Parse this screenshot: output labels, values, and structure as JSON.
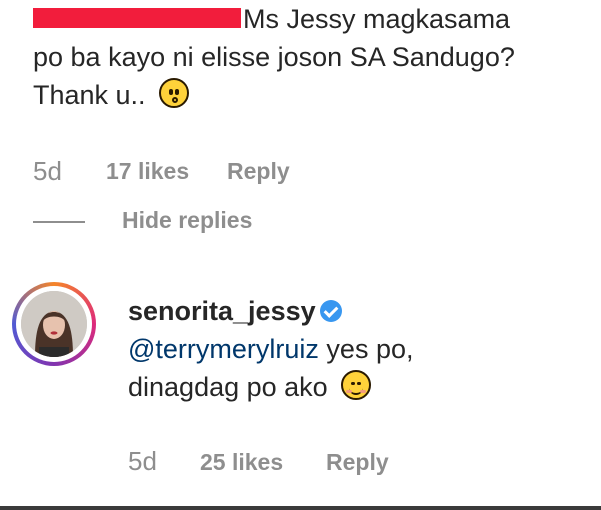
{
  "comment": {
    "username_redacted": "terrymerylruiz",
    "line1": "Ms Jessy magkasama",
    "line2": "po ba kayo ni elisse joson SA Sandugo?",
    "line3": "Thank u..",
    "emoji": "face-with-open-mouth-emoji",
    "meta": {
      "age": "5d",
      "likes": "17 likes",
      "reply": "Reply"
    },
    "hide_replies": "Hide replies"
  },
  "reply": {
    "username": "senorita_jessy",
    "mention": "@terrymerylruiz",
    "text1": " yes po,",
    "text2": "dinagdag po ako",
    "emoji": "smiling-face-emoji",
    "meta": {
      "age": "5d",
      "likes": "25 likes",
      "reply": "Reply"
    }
  },
  "colors": {
    "redaction": "#f21d3c",
    "verified": "#3897f0",
    "mention": "#00376b",
    "meta": "#8e8e8e"
  }
}
